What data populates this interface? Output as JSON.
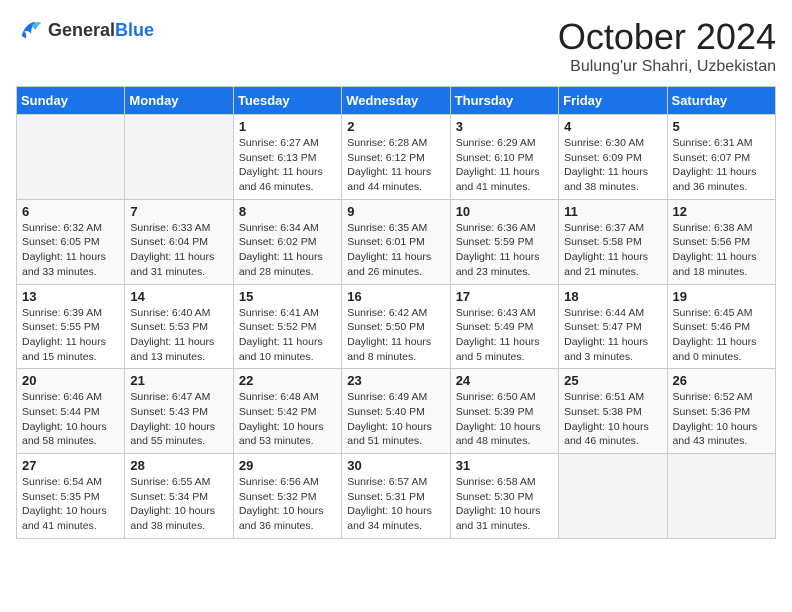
{
  "logo": {
    "general": "General",
    "blue": "Blue"
  },
  "title": "October 2024",
  "subtitle": "Bulung'ur Shahri, Uzbekistan",
  "headers": [
    "Sunday",
    "Monday",
    "Tuesday",
    "Wednesday",
    "Thursday",
    "Friday",
    "Saturday"
  ],
  "weeks": [
    [
      {
        "day": "",
        "detail": ""
      },
      {
        "day": "",
        "detail": ""
      },
      {
        "day": "1",
        "detail": "Sunrise: 6:27 AM\nSunset: 6:13 PM\nDaylight: 11 hours and 46 minutes."
      },
      {
        "day": "2",
        "detail": "Sunrise: 6:28 AM\nSunset: 6:12 PM\nDaylight: 11 hours and 44 minutes."
      },
      {
        "day": "3",
        "detail": "Sunrise: 6:29 AM\nSunset: 6:10 PM\nDaylight: 11 hours and 41 minutes."
      },
      {
        "day": "4",
        "detail": "Sunrise: 6:30 AM\nSunset: 6:09 PM\nDaylight: 11 hours and 38 minutes."
      },
      {
        "day": "5",
        "detail": "Sunrise: 6:31 AM\nSunset: 6:07 PM\nDaylight: 11 hours and 36 minutes."
      }
    ],
    [
      {
        "day": "6",
        "detail": "Sunrise: 6:32 AM\nSunset: 6:05 PM\nDaylight: 11 hours and 33 minutes."
      },
      {
        "day": "7",
        "detail": "Sunrise: 6:33 AM\nSunset: 6:04 PM\nDaylight: 11 hours and 31 minutes."
      },
      {
        "day": "8",
        "detail": "Sunrise: 6:34 AM\nSunset: 6:02 PM\nDaylight: 11 hours and 28 minutes."
      },
      {
        "day": "9",
        "detail": "Sunrise: 6:35 AM\nSunset: 6:01 PM\nDaylight: 11 hours and 26 minutes."
      },
      {
        "day": "10",
        "detail": "Sunrise: 6:36 AM\nSunset: 5:59 PM\nDaylight: 11 hours and 23 minutes."
      },
      {
        "day": "11",
        "detail": "Sunrise: 6:37 AM\nSunset: 5:58 PM\nDaylight: 11 hours and 21 minutes."
      },
      {
        "day": "12",
        "detail": "Sunrise: 6:38 AM\nSunset: 5:56 PM\nDaylight: 11 hours and 18 minutes."
      }
    ],
    [
      {
        "day": "13",
        "detail": "Sunrise: 6:39 AM\nSunset: 5:55 PM\nDaylight: 11 hours and 15 minutes."
      },
      {
        "day": "14",
        "detail": "Sunrise: 6:40 AM\nSunset: 5:53 PM\nDaylight: 11 hours and 13 minutes."
      },
      {
        "day": "15",
        "detail": "Sunrise: 6:41 AM\nSunset: 5:52 PM\nDaylight: 11 hours and 10 minutes."
      },
      {
        "day": "16",
        "detail": "Sunrise: 6:42 AM\nSunset: 5:50 PM\nDaylight: 11 hours and 8 minutes."
      },
      {
        "day": "17",
        "detail": "Sunrise: 6:43 AM\nSunset: 5:49 PM\nDaylight: 11 hours and 5 minutes."
      },
      {
        "day": "18",
        "detail": "Sunrise: 6:44 AM\nSunset: 5:47 PM\nDaylight: 11 hours and 3 minutes."
      },
      {
        "day": "19",
        "detail": "Sunrise: 6:45 AM\nSunset: 5:46 PM\nDaylight: 11 hours and 0 minutes."
      }
    ],
    [
      {
        "day": "20",
        "detail": "Sunrise: 6:46 AM\nSunset: 5:44 PM\nDaylight: 10 hours and 58 minutes."
      },
      {
        "day": "21",
        "detail": "Sunrise: 6:47 AM\nSunset: 5:43 PM\nDaylight: 10 hours and 55 minutes."
      },
      {
        "day": "22",
        "detail": "Sunrise: 6:48 AM\nSunset: 5:42 PM\nDaylight: 10 hours and 53 minutes."
      },
      {
        "day": "23",
        "detail": "Sunrise: 6:49 AM\nSunset: 5:40 PM\nDaylight: 10 hours and 51 minutes."
      },
      {
        "day": "24",
        "detail": "Sunrise: 6:50 AM\nSunset: 5:39 PM\nDaylight: 10 hours and 48 minutes."
      },
      {
        "day": "25",
        "detail": "Sunrise: 6:51 AM\nSunset: 5:38 PM\nDaylight: 10 hours and 46 minutes."
      },
      {
        "day": "26",
        "detail": "Sunrise: 6:52 AM\nSunset: 5:36 PM\nDaylight: 10 hours and 43 minutes."
      }
    ],
    [
      {
        "day": "27",
        "detail": "Sunrise: 6:54 AM\nSunset: 5:35 PM\nDaylight: 10 hours and 41 minutes."
      },
      {
        "day": "28",
        "detail": "Sunrise: 6:55 AM\nSunset: 5:34 PM\nDaylight: 10 hours and 38 minutes."
      },
      {
        "day": "29",
        "detail": "Sunrise: 6:56 AM\nSunset: 5:32 PM\nDaylight: 10 hours and 36 minutes."
      },
      {
        "day": "30",
        "detail": "Sunrise: 6:57 AM\nSunset: 5:31 PM\nDaylight: 10 hours and 34 minutes."
      },
      {
        "day": "31",
        "detail": "Sunrise: 6:58 AM\nSunset: 5:30 PM\nDaylight: 10 hours and 31 minutes."
      },
      {
        "day": "",
        "detail": ""
      },
      {
        "day": "",
        "detail": ""
      }
    ]
  ]
}
